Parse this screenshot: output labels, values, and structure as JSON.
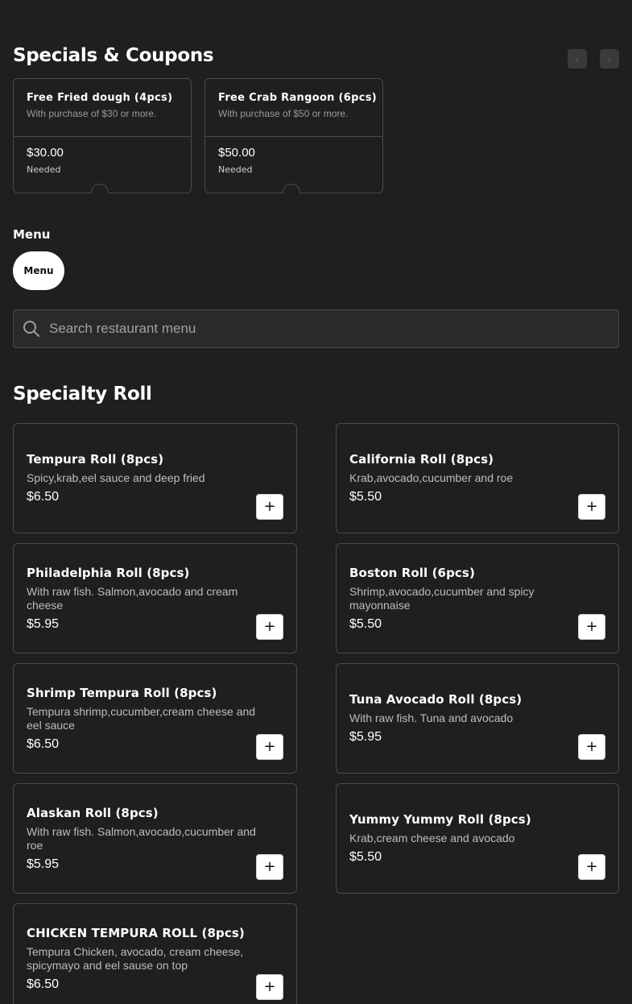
{
  "specials": {
    "title": "Specials & Coupons",
    "prev_icon": "‹",
    "next_icon": "›",
    "coupons": [
      {
        "title": "Free Fried dough (4pcs)",
        "subtitle": "With purchase of $30 or more.",
        "amount": "$30.00",
        "label": "Needed"
      },
      {
        "title": "Free Crab Rangoon (6pcs)",
        "subtitle": "With purchase of $50 or more.",
        "amount": "$50.00",
        "label": "Needed"
      }
    ]
  },
  "menu": {
    "label": "Menu",
    "pill": "Menu"
  },
  "search": {
    "placeholder": "Search restaurant menu",
    "value": ""
  },
  "section": {
    "title": "Specialty Roll",
    "add_icon": "+",
    "items": [
      {
        "name": "Tempura Roll (8pcs)",
        "description": "Spicy,krab,eel sauce and deep fried",
        "price": "$6.50"
      },
      {
        "name": "California Roll (8pcs)",
        "description": "Krab,avocado,cucumber and roe",
        "price": "$5.50"
      },
      {
        "name": "Philadelphia Roll (8pcs)",
        "description": "With raw fish. Salmon,avocado and cream cheese",
        "price": "$5.95"
      },
      {
        "name": "Boston Roll (6pcs)",
        "description": "Shrimp,avocado,cucumber and spicy mayonnaise",
        "price": "$5.50"
      },
      {
        "name": "Shrimp Tempura Roll (8pcs)",
        "description": "Tempura shrimp,cucumber,cream cheese and eel sauce",
        "price": "$6.50"
      },
      {
        "name": "Tuna Avocado Roll (8pcs)",
        "description": "With raw fish. Tuna and avocado",
        "price": "$5.95"
      },
      {
        "name": "Alaskan Roll (8pcs)",
        "description": "With raw fish. Salmon,avocado,cucumber and roe",
        "price": "$5.95"
      },
      {
        "name": "Yummy Yummy Roll (8pcs)",
        "description": "Krab,cream cheese and avocado",
        "price": "$5.50"
      },
      {
        "name": "CHICKEN TEMPURA ROLL (8pcs)",
        "description": "Tempura Chicken, avocado, cream cheese, spicymayo and eel sause on top",
        "price": "$6.50"
      }
    ]
  },
  "colors": {
    "background": "#1f1f1f",
    "border": "#4a4a4a",
    "text": "#ffffff",
    "muted_text": "#bdbdbd"
  }
}
